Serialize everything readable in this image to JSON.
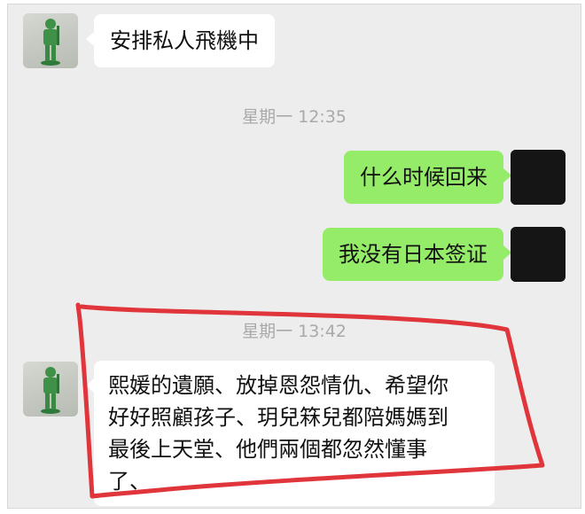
{
  "messages": [
    {
      "sender": "friend",
      "text": "安排私人飛機中"
    },
    {
      "timestamp": "星期一 12:35"
    },
    {
      "sender": "me",
      "text": "什么时候回来"
    },
    {
      "sender": "me",
      "text": "我没有日本签证"
    },
    {
      "timestamp": "星期一 13:42"
    },
    {
      "sender": "friend",
      "text": "熙媛的遺願、放掉恩怨情仇、希望你\n好好照顧孩子、玥兒箖兒都陪媽媽到\n最後上天堂、他們兩個都忽然懂事\n了、"
    }
  ],
  "colors": {
    "background": "#ededed",
    "incoming_bubble": "#ffffff",
    "outgoing_bubble": "#95ec69",
    "timestamp_text": "#a9a9a9",
    "annotation_stroke": "#e0353b"
  },
  "icons": {
    "friend_avatar": "toy-soldier-avatar-icon",
    "me_avatar": "dark-avatar-icon"
  }
}
